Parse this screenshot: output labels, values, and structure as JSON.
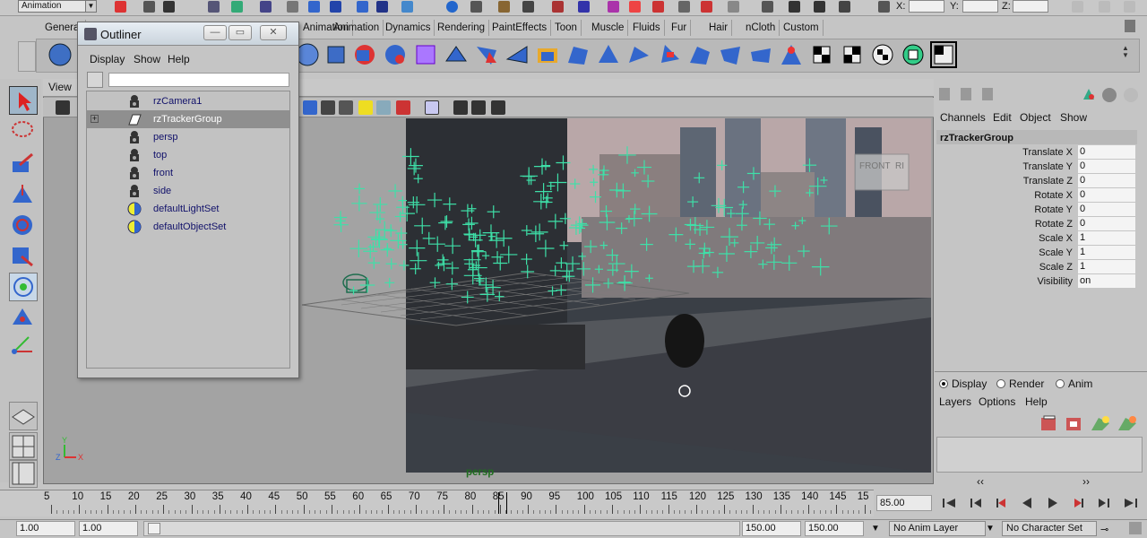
{
  "status_line": {
    "mode": "Animation",
    "coords": [
      "X:",
      "Y:",
      "Z:"
    ]
  },
  "shelf": {
    "tabs": [
      "General",
      "Animation",
      "Animation",
      "Dynamics",
      "Rendering",
      "PaintEffects",
      "Toon",
      "Muscle",
      "Fluids",
      "Fur",
      "Hair",
      "nCloth",
      "Custom"
    ]
  },
  "viewport": {
    "menu": [
      "View"
    ],
    "camera_label": "persp",
    "view_cube": [
      "FRONT",
      "RI"
    ],
    "axis": [
      "Y",
      "Z",
      "X"
    ]
  },
  "outliner": {
    "title": "Outliner",
    "menu": [
      "Display",
      "Show",
      "Help"
    ],
    "items": [
      {
        "label": "rzCamera1",
        "icon": "camera-icon",
        "selected": false
      },
      {
        "label": "rzTrackerGroup",
        "icon": "group-icon",
        "selected": true
      },
      {
        "label": "persp",
        "icon": "camera-icon",
        "selected": false
      },
      {
        "label": "top",
        "icon": "camera-icon",
        "selected": false
      },
      {
        "label": "front",
        "icon": "camera-icon",
        "selected": false
      },
      {
        "label": "side",
        "icon": "camera-icon",
        "selected": false
      },
      {
        "label": "defaultLightSet",
        "icon": "set-icon",
        "selected": false
      },
      {
        "label": "defaultObjectSet",
        "icon": "set-icon",
        "selected": false
      }
    ]
  },
  "channel_box": {
    "menu": [
      "Channels",
      "Edit",
      "Object",
      "Show"
    ],
    "node": "rzTrackerGroup",
    "attributes": [
      {
        "name": "Translate X",
        "value": "0"
      },
      {
        "name": "Translate Y",
        "value": "0"
      },
      {
        "name": "Translate Z",
        "value": "0"
      },
      {
        "name": "Rotate X",
        "value": "0"
      },
      {
        "name": "Rotate Y",
        "value": "0"
      },
      {
        "name": "Rotate Z",
        "value": "0"
      },
      {
        "name": "Scale X",
        "value": "1"
      },
      {
        "name": "Scale Y",
        "value": "1"
      },
      {
        "name": "Scale Z",
        "value": "1"
      },
      {
        "name": "Visibility",
        "value": "on"
      }
    ]
  },
  "layers": {
    "modes": [
      "Display",
      "Render",
      "Anim"
    ],
    "selected_mode": "Display",
    "menu": [
      "Layers",
      "Options",
      "Help"
    ],
    "scroll_left": "‹‹",
    "scroll_right": "››"
  },
  "timeline": {
    "ticks": [
      "5",
      "10",
      "15",
      "20",
      "25",
      "30",
      "35",
      "40",
      "45",
      "50",
      "55",
      "60",
      "65",
      "70",
      "75",
      "80",
      "85",
      "90",
      "95",
      "100",
      "105",
      "110",
      "115",
      "120",
      "125",
      "130",
      "135",
      "140",
      "145",
      "15"
    ],
    "current_frame": "85.00"
  },
  "range": {
    "start": "1.00",
    "playback_start": "1.00",
    "playback_end": "150.00",
    "end": "150.00",
    "anim_layer": "No Anim Layer",
    "character_set": "No Character Set"
  }
}
